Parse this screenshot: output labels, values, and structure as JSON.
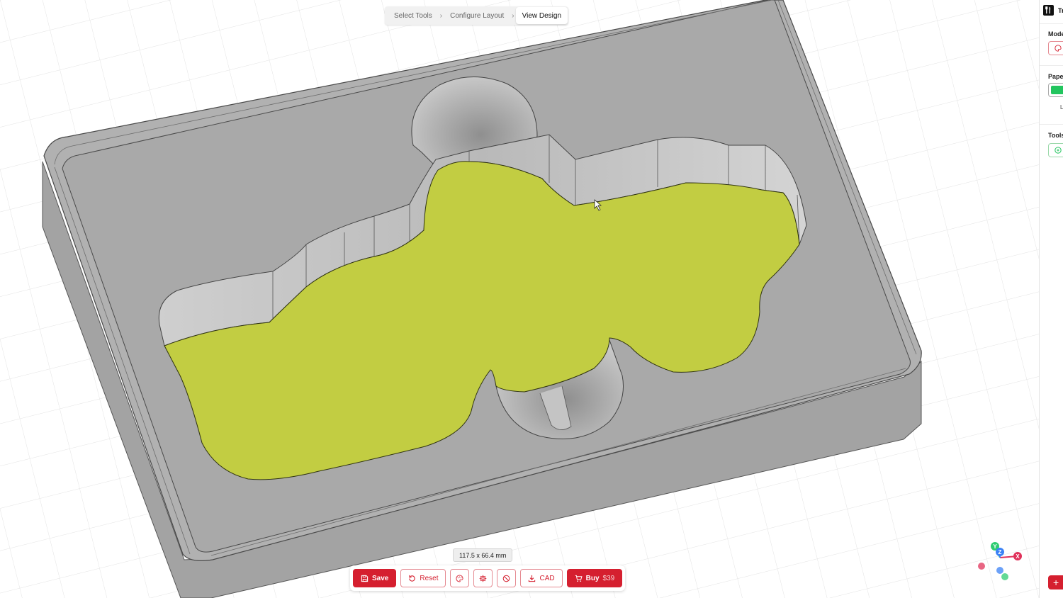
{
  "breadcrumb": {
    "steps": [
      {
        "label": "Select Tools"
      },
      {
        "label": "Configure Layout"
      },
      {
        "label": "View Design"
      }
    ],
    "active_index": 2
  },
  "dimensions": {
    "label": "117.5 x 66.4 mm"
  },
  "toolbar": {
    "save_label": "Save",
    "reset_label": "Reset",
    "cad_label": "CAD",
    "buy_label": "Buy",
    "buy_price": "$39"
  },
  "axes": {
    "x_label": "X",
    "y_label": "Y",
    "z_label": "Z"
  },
  "sidebar": {
    "app_title": "Tr",
    "model_label": "Mode",
    "paper_label": "Pape",
    "paper_sub": "Le",
    "tools_label": "Tools",
    "add_label": "+"
  },
  "colors": {
    "accent": "#d51f2f",
    "foam_insert": "#c2cd42",
    "tray_gray": "#a9a9a9",
    "paper_swatch": "#22c55e",
    "axis_x": "#e0315a",
    "axis_y": "#2ecc71",
    "axis_z": "#3b82f6"
  },
  "icons": {
    "save": "save-icon",
    "reset": "rotate-icon",
    "palette": "palette-icon",
    "settings": "gear-icon",
    "no_entry": "prohibited-icon",
    "cad": "download-icon",
    "buy": "cart-icon"
  }
}
